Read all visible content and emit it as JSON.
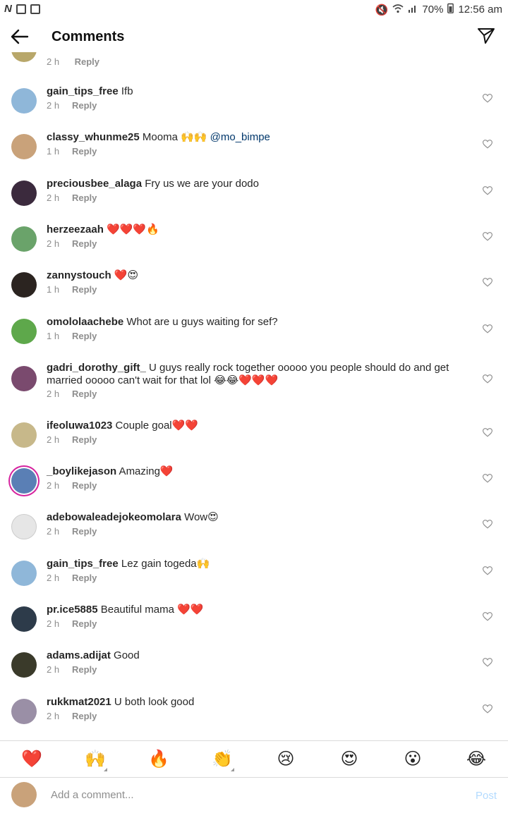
{
  "status_bar": {
    "left_icons": [
      "netflix-n-icon",
      "screen-icon",
      "sim-icon"
    ],
    "app_letter": "N",
    "battery": "70%",
    "time": "12:56 am",
    "right_icons": [
      "mute-icon",
      "wifi-icon",
      "signal-icon",
      "battery-icon"
    ]
  },
  "header": {
    "title": "Comments",
    "back_icon": "back-arrow-icon",
    "share_icon": "send-icon"
  },
  "partial_comment": {
    "time": "2 h",
    "reply": "Reply"
  },
  "comments": [
    {
      "username": "gain_tips_free",
      "text": " Ifb",
      "time": "2 h",
      "reply": "Reply",
      "avatar_color": "#8fb7d9"
    },
    {
      "username": "classy_whunme25",
      "text": " Mooma 🙌🙌 ",
      "mention": "@mo_bimpe",
      "time": "1 h",
      "reply": "Reply",
      "avatar_color": "#c9a27a"
    },
    {
      "username": "preciousbee_alaga",
      "text": " Fry us we are your dodo",
      "time": "2 h",
      "reply": "Reply",
      "avatar_color": "#3b2a3d"
    },
    {
      "username": "herzeezaah",
      "text": " ❤️❤️❤️🔥",
      "time": "2 h",
      "reply": "Reply",
      "avatar_color": "#6aa36a"
    },
    {
      "username": "zannystouch",
      "text": " ❤️😍",
      "time": "1 h",
      "reply": "Reply",
      "avatar_color": "#2b2420"
    },
    {
      "username": "omololaachebe",
      "text": " Whot are u guys waiting for sef?",
      "time": "1 h",
      "reply": "Reply",
      "avatar_color": "#5ea84b"
    },
    {
      "username": "gadri_dorothy_gift_",
      "text": " U guys really rock together ooooo you people should do and get married ooooo can't wait for that lol 😂😂❤️❤️❤️",
      "time": "2 h",
      "reply": "Reply",
      "avatar_color": "#7a4a6e"
    },
    {
      "username": "ifeoluwa1023",
      "text": " Couple goal❤️❤️",
      "time": "2 h",
      "reply": "Reply",
      "avatar_color": "#c7b88a"
    },
    {
      "username": "_boylikejason",
      "text": " Amazing❤️",
      "time": "2 h",
      "reply": "Reply",
      "avatar_color": "#5a7fb5",
      "story_ring": true
    },
    {
      "username": "adebowaleadejokeomolara",
      "text": " Wow😍",
      "time": "2 h",
      "reply": "Reply",
      "avatar_color": "#e6e6e6",
      "default_avatar": true
    },
    {
      "username": "gain_tips_free",
      "text": " Lez gain togeda🙌",
      "time": "2 h",
      "reply": "Reply",
      "avatar_color": "#8fb7d9"
    },
    {
      "username": "pr.ice5885",
      "text": " Beautiful mama ❤️❤️",
      "time": "2 h",
      "reply": "Reply",
      "avatar_color": "#2d3b4a"
    },
    {
      "username": "adams.adijat",
      "text": " Good",
      "time": "2 h",
      "reply": "Reply",
      "avatar_color": "#3a3a2a"
    },
    {
      "username": "rukkmat2021",
      "text": " U both look good",
      "time": "2 h",
      "reply": "Reply",
      "avatar_color": "#9a8fa6"
    }
  ],
  "emoji_bar": [
    {
      "glyph": "❤️",
      "icon": "red-heart-emoji"
    },
    {
      "glyph": "🙌",
      "icon": "raising-hands-emoji",
      "has_skin_tone": true
    },
    {
      "glyph": "🔥",
      "icon": "fire-emoji"
    },
    {
      "glyph": "👏",
      "icon": "clapping-hands-emoji",
      "has_skin_tone": true
    },
    {
      "glyph": "😢",
      "icon": "crying-face-emoji"
    },
    {
      "glyph": "😍",
      "icon": "heart-eyes-emoji"
    },
    {
      "glyph": "😮",
      "icon": "surprised-face-emoji"
    },
    {
      "glyph": "😂",
      "icon": "tears-of-joy-emoji"
    }
  ],
  "composer": {
    "placeholder": "Add a comment...",
    "post_label": "Post",
    "avatar_color": "#c9a27a"
  },
  "colors": {
    "text": "#262626",
    "secondary": "#8e8e8e",
    "mention": "#00376b",
    "post_disabled": "#b3dbff",
    "divider": "#dbdbdb"
  }
}
